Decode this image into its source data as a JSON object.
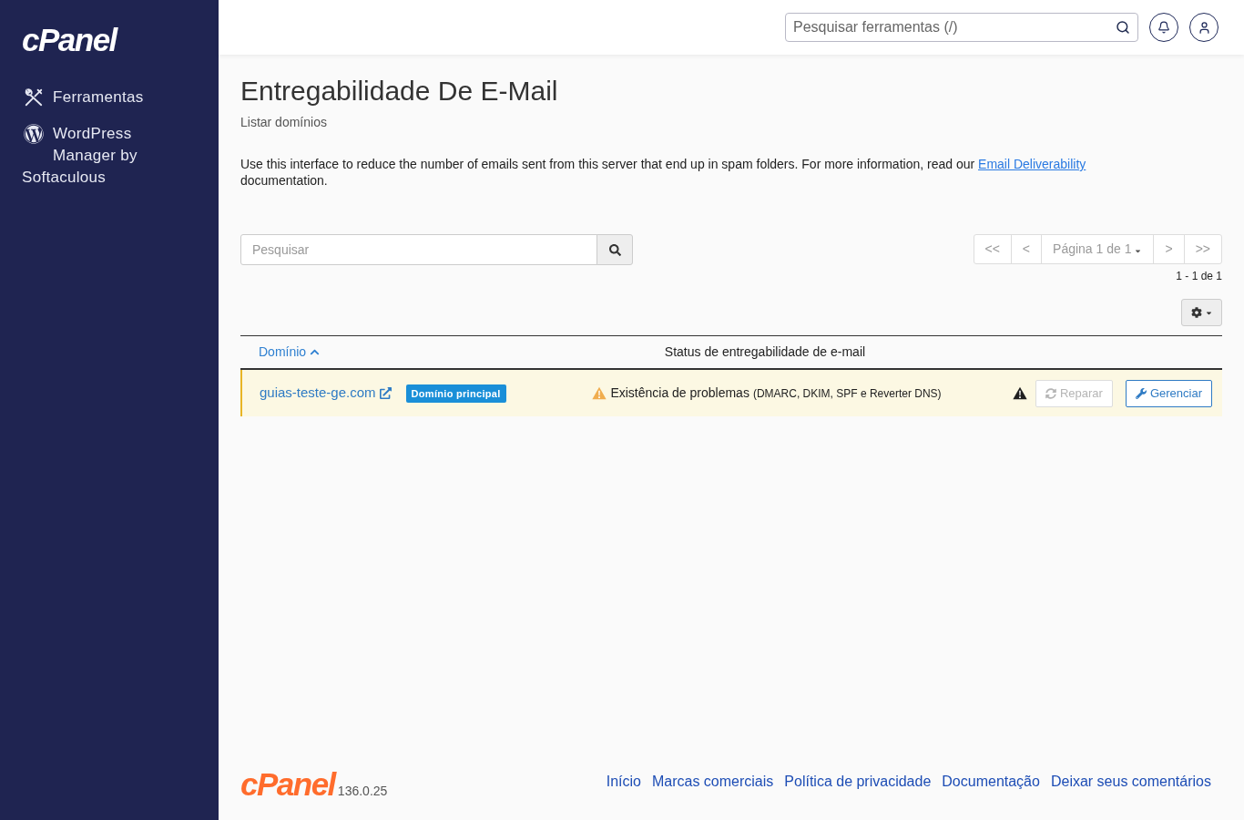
{
  "sidebar": {
    "logo": "cPanel",
    "items": [
      {
        "label": "Ferramentas"
      },
      {
        "label": "WordPress Manager by Softaculous"
      }
    ]
  },
  "top_bar": {
    "search": {
      "placeholder": "Pesquisar ferramentas (/)"
    }
  },
  "page": {
    "title": "Entregabilidade De E-Mail",
    "subtitle": "Listar domínios",
    "description": "Use this interface to reduce the number of emails sent from this server that end up in spam folders. For more information, read our",
    "description_link": "Email Deliverability",
    "description_end": "documentation."
  },
  "toolbar": {
    "search": {
      "placeholder": "Pesquisar"
    },
    "pagination": [
      {
        "label": "<<",
        "kind": "step",
        "disabled": true
      },
      {
        "label": "<",
        "kind": "step",
        "disabled": true
      },
      {
        "label": "Página 1 de 1",
        "kind": "select",
        "disabled": true
      },
      {
        "label": ">",
        "kind": "step",
        "disabled": true
      },
      {
        "label": ">>",
        "kind": "step",
        "disabled": true
      }
    ],
    "range": "1 - 1 de 1"
  },
  "table": {
    "columns": [
      {
        "label": "Domínio",
        "sorted": true,
        "ascending": true
      },
      {
        "label": "Status de entregabilidade de e-mail",
        "sorted": false
      }
    ],
    "rows": [
      {
        "domain": "guias-teste-ge.com",
        "badge": "Domínio principal",
        "status": {
          "kind": "warning",
          "text": "Existência de problemas",
          "detail": "(DMARC, DKIM, SPF e Reverter DNS)"
        },
        "actions": [
          {
            "label": "Reparar",
            "disabled": true
          },
          {
            "label": "Gerenciar",
            "disabled": false
          }
        ]
      }
    ]
  },
  "footer": {
    "logo": "cPanel",
    "version": "136.0.25",
    "links": [
      "Início",
      "Marcas comerciais",
      "Política de privacidade",
      "Documentação",
      "Deixar seus comentários"
    ]
  }
}
